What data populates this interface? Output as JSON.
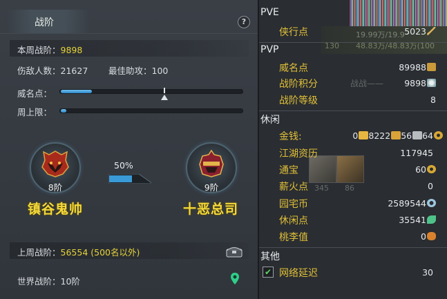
{
  "left": {
    "tab_title": "战阶",
    "help": "?",
    "this_week_label": "本周战阶：",
    "this_week_value": "9898",
    "defeated_label": "伤敌人数：",
    "defeated_value": "21627",
    "assist_label": "最佳助攻：",
    "assist_value": "100",
    "prestige_label": "威名点：",
    "prestige_progress": 0.17,
    "weekly_cap_label": "周上限：",
    "weekly_cap_progress": 0.02,
    "current_rank": {
      "level": "8阶",
      "name": "镇谷鬼帅"
    },
    "next_rank": {
      "level": "9阶",
      "name": "十恶总司"
    },
    "progress_percent": "50%",
    "progress_fraction": 0.5,
    "last_week_label": "上周战阶：",
    "last_week_value": "56554 (500名以外)",
    "world_label": "世界战阶：",
    "world_value": "10阶"
  },
  "right": {
    "bg_stat1": "19.99万/19.9",
    "bg_stat2": "48.83万/48.83万(100",
    "bg_stat3": "130",
    "bg_text_mid": "战战——",
    "slot_numbers": [
      "345",
      "86"
    ],
    "sections": {
      "pve": "PVE",
      "pvp": "PVP",
      "leisure": "休闲",
      "other": "其他"
    },
    "pve_items": [
      {
        "label": "侠行点",
        "value": "5023",
        "icon": "sword-icon"
      }
    ],
    "pvp_items": [
      {
        "label": "威名点",
        "value": "89988",
        "icon": "pouch-icon"
      },
      {
        "label": "战阶积分",
        "value": "9898",
        "icon": "medal-icon"
      },
      {
        "label": "战阶等级",
        "value": "8",
        "icon": ""
      }
    ],
    "leisure_money": {
      "label": "金钱:",
      "gold": "0",
      "silver": "8222",
      "copper": "56",
      "coin": "64"
    },
    "leisure_items": [
      {
        "label": "江湖资历",
        "value": "117945",
        "icon": ""
      },
      {
        "label": "通宝",
        "value": "60",
        "icon": "coin-icon"
      },
      {
        "label": "薪火点",
        "value": "0",
        "icon": ""
      },
      {
        "label": "园宅币",
        "value": "2589544",
        "icon": "swirl-icon"
      },
      {
        "label": "休闲点",
        "value": "35541",
        "icon": "leaf-icon"
      },
      {
        "label": "桃李值",
        "value": "0",
        "icon": "gourd-icon"
      }
    ],
    "other_items": [
      {
        "label": "网络延迟",
        "value": "30",
        "checked": true
      }
    ]
  }
}
